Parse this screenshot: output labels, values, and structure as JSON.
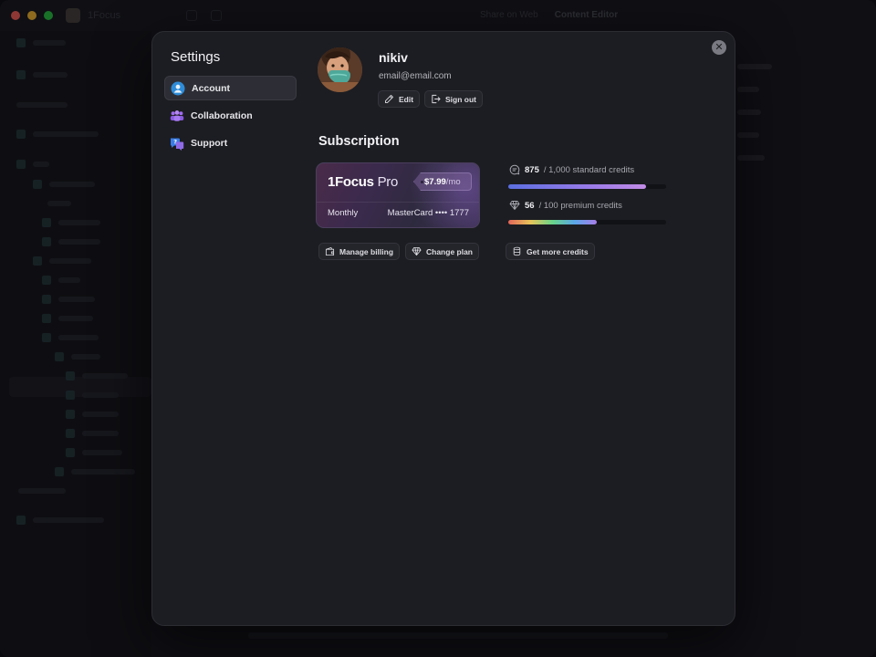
{
  "background_app": {
    "titlebar": {
      "app_name": "1Focus",
      "center_left": "Share on Web",
      "center_right": "Content Editor"
    }
  },
  "settings": {
    "title": "Settings",
    "close_label": "✕",
    "nav": [
      {
        "label": "Account",
        "icon": "account-icon",
        "active": true
      },
      {
        "label": "Collaboration",
        "icon": "collaboration-icon",
        "active": false
      },
      {
        "label": "Support",
        "icon": "support-icon",
        "active": false
      }
    ]
  },
  "profile": {
    "username": "nikiv",
    "email": "email@email.com",
    "edit_label": "Edit",
    "sign_out_label": "Sign out"
  },
  "subscription": {
    "title": "Subscription",
    "plan": {
      "brand": "1Focus",
      "tier": "Pro",
      "price": "$7.99",
      "period": "/mo",
      "cycle": "Monthly",
      "card": "MasterCard •••• 1777"
    },
    "credits": {
      "standard": {
        "used": "875",
        "total_text": "/ 1,000 standard credits",
        "fraction": 0.875
      },
      "premium": {
        "used": "56",
        "total_text": "/ 100 premium credits",
        "fraction": 0.56
      }
    },
    "actions": {
      "manage_billing": "Manage billing",
      "change_plan": "Change plan",
      "get_more_credits": "Get more credits"
    }
  },
  "colors": {
    "modal_bg": "#1c1d22",
    "accent_blue": "#2f8cd8",
    "accent_purple": "#8f6ce6"
  }
}
